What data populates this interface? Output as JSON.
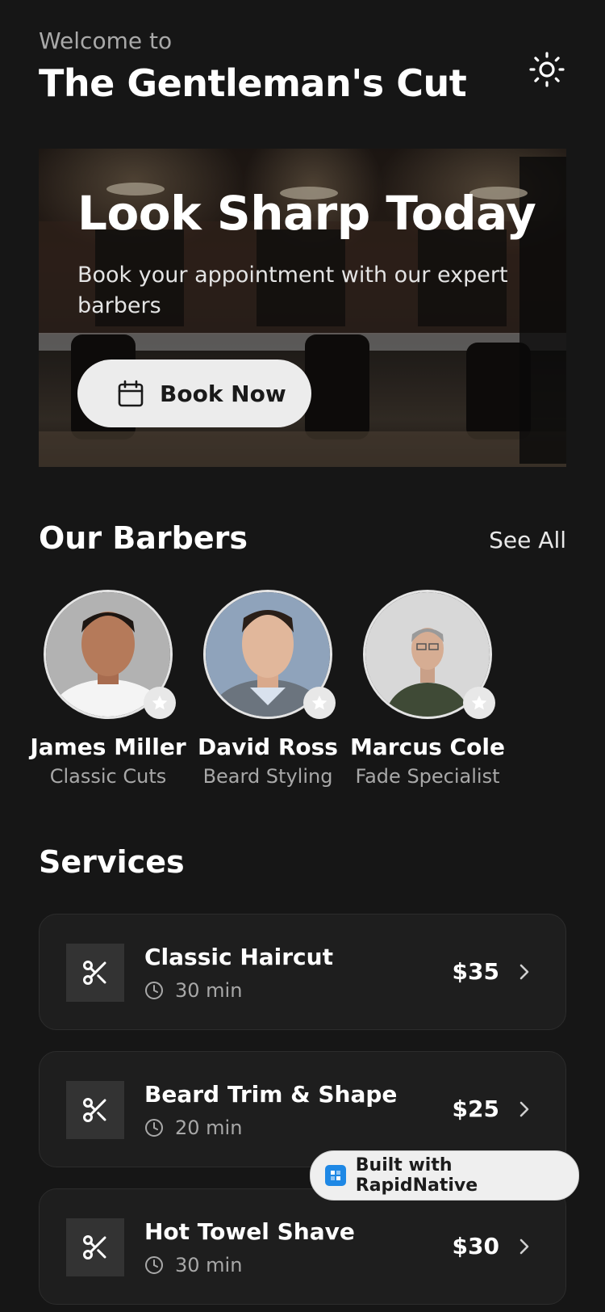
{
  "header": {
    "welcome": "Welcome to",
    "title": "The Gentleman's Cut",
    "theme_icon": "sun-icon"
  },
  "hero": {
    "title": "Look Sharp Today",
    "subtitle": "Book your appointment with our expert barbers",
    "button_label": "Book Now",
    "button_icon": "calendar-icon"
  },
  "barbers_section": {
    "title": "Our Barbers",
    "see_all": "See All",
    "items": [
      {
        "name": "James Miller",
        "specialty": "Classic Cuts"
      },
      {
        "name": "David Ross",
        "specialty": "Beard Styling"
      },
      {
        "name": "Marcus Cole",
        "specialty": "Fade Specialist"
      }
    ]
  },
  "services_section": {
    "title": "Services",
    "items": [
      {
        "name": "Classic Haircut",
        "duration": "30 min",
        "price": "$35"
      },
      {
        "name": "Beard Trim & Shape",
        "duration": "20 min",
        "price": "$25"
      },
      {
        "name": "Hot Towel Shave",
        "duration": "30 min",
        "price": "$30"
      }
    ]
  },
  "badge": {
    "label": "Built with RapidNative"
  },
  "colors": {
    "background": "#161616",
    "card": "#1e1e1e",
    "text_muted": "#a8a8a8",
    "button": "#ececec"
  }
}
